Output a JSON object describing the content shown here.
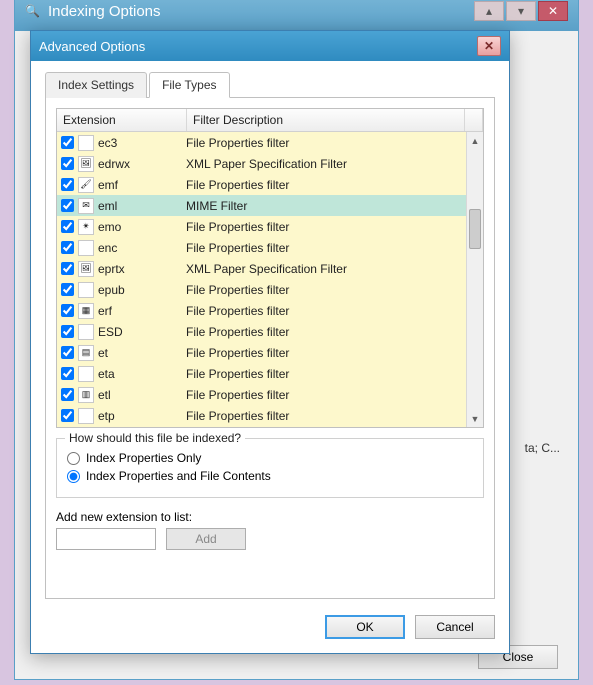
{
  "parent": {
    "title": "Indexing Options",
    "rightnote": "ta; C...",
    "close_label": "Close"
  },
  "dialog": {
    "title": "Advanced Options",
    "tabs": {
      "index_settings": "Index Settings",
      "file_types": "File Types"
    },
    "columns": {
      "extension": "Extension",
      "filter_description": "Filter Description"
    },
    "rows": [
      {
        "ext": "ec3",
        "desc": "File Properties filter",
        "icon": "",
        "selected": false
      },
      {
        "ext": "edrwx",
        "desc": "XML Paper Specification Filter",
        "icon": "🖼",
        "selected": false
      },
      {
        "ext": "emf",
        "desc": "File Properties filter",
        "icon": "🖌",
        "selected": false
      },
      {
        "ext": "eml",
        "desc": "MIME Filter",
        "icon": "✉",
        "selected": true
      },
      {
        "ext": "emo",
        "desc": "File Properties filter",
        "icon": "✴",
        "selected": false
      },
      {
        "ext": "enc",
        "desc": "File Properties filter",
        "icon": "",
        "selected": false
      },
      {
        "ext": "eprtx",
        "desc": "XML Paper Specification Filter",
        "icon": "🖼",
        "selected": false
      },
      {
        "ext": "epub",
        "desc": "File Properties filter",
        "icon": "",
        "selected": false
      },
      {
        "ext": "erf",
        "desc": "File Properties filter",
        "icon": "▦",
        "selected": false
      },
      {
        "ext": "ESD",
        "desc": "File Properties filter",
        "icon": "",
        "selected": false
      },
      {
        "ext": "et",
        "desc": "File Properties filter",
        "icon": "▤",
        "selected": false
      },
      {
        "ext": "eta",
        "desc": "File Properties filter",
        "icon": "",
        "selected": false
      },
      {
        "ext": "etl",
        "desc": "File Properties filter",
        "icon": "▥",
        "selected": false
      },
      {
        "ext": "etp",
        "desc": "File Properties filter",
        "icon": "",
        "selected": false
      }
    ],
    "groupbox": {
      "legend": "How should this file be indexed?",
      "radio_props_only": "Index Properties Only",
      "radio_props_contents": "Index Properties and File Contents"
    },
    "add_ext": {
      "label": "Add new extension to list:",
      "button": "Add",
      "value": ""
    },
    "buttons": {
      "ok": "OK",
      "cancel": "Cancel"
    }
  }
}
